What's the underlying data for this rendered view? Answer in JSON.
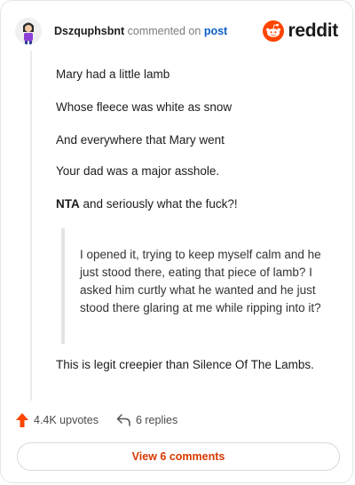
{
  "header": {
    "username": "Dszquphsbnt",
    "action_text": "commented on",
    "post_link": "post",
    "logo_text": "reddit"
  },
  "comment": {
    "lines": [
      "Mary had a little lamb",
      "Whose fleece was white as snow",
      "And everywhere that Mary went",
      "Your dad was a major asshole."
    ],
    "verdict_bold": "NTA",
    "verdict_rest": " and seriously what the fuck?!",
    "quote": "I opened it, trying to keep myself calm and he just stood there, eating that piece of lamb? I asked him curtly what he wanted and he just stood there glaring at me while ripping into it?",
    "closing": "This is legit creepier than Silence Of The Lambs."
  },
  "actions": {
    "upvotes": "4.4K upvotes",
    "replies": "6 replies"
  },
  "footer": {
    "view_label": "View 6 comments"
  },
  "colors": {
    "accent": "#d93900",
    "upvote": "#ff4500",
    "link": "#0a5ec9"
  }
}
